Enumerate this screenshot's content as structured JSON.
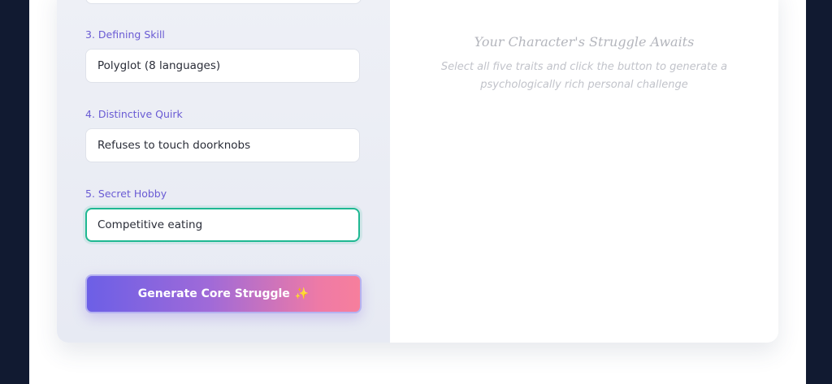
{
  "form": {
    "fields": [
      {
        "label": "3. Defining Skill",
        "value": "Polyglot (8 languages)"
      },
      {
        "label": "4. Distinctive Quirk",
        "value": "Refuses to touch doorknobs"
      },
      {
        "label": "5. Secret Hobby",
        "value": "Competitive eating"
      }
    ],
    "generate_label": "Generate Core Struggle",
    "generate_icon": "✨"
  },
  "result": {
    "placeholder_title": "Your Character's Struggle Awaits",
    "placeholder_text": "Select all five traits and click the button to generate a psychologically rich personal challenge"
  },
  "colors": {
    "background": "#111a31",
    "label": "#6a5bd4",
    "focus_border": "#1fb892",
    "button_gradient_start": "#6c5fe6",
    "button_gradient_end": "#f77f9c"
  }
}
